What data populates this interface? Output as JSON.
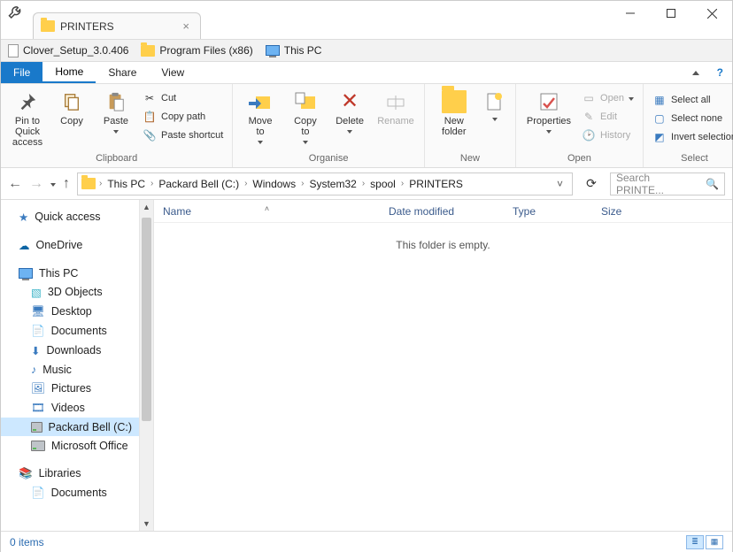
{
  "window": {
    "tab_title": "PRINTERS"
  },
  "bookmarks": [
    {
      "label": "Clover_Setup_3.0.406",
      "icon": "doc"
    },
    {
      "label": "Program Files (x86)",
      "icon": "folder"
    },
    {
      "label": "This PC",
      "icon": "pc"
    }
  ],
  "ribbon_tabs": {
    "file": "File",
    "home": "Home",
    "share": "Share",
    "view": "View"
  },
  "ribbon": {
    "clipboard": {
      "label": "Clipboard",
      "pin": "Pin to Quick access",
      "copy": "Copy",
      "paste": "Paste",
      "cut": "Cut",
      "copy_path": "Copy path",
      "paste_shortcut": "Paste shortcut"
    },
    "organise": {
      "label": "Organise",
      "move_to": "Move to",
      "copy_to": "Copy to",
      "delete": "Delete",
      "rename": "Rename"
    },
    "new": {
      "label": "New",
      "new_folder": "New folder"
    },
    "open": {
      "label": "Open",
      "properties": "Properties",
      "open": "Open",
      "edit": "Edit",
      "history": "History"
    },
    "select": {
      "label": "Select",
      "select_all": "Select all",
      "select_none": "Select none",
      "invert": "Invert selection"
    }
  },
  "breadcrumb": [
    "This PC",
    "Packard Bell (C:)",
    "Windows",
    "System32",
    "spool",
    "PRINTERS"
  ],
  "search": {
    "placeholder": "Search PRINTE..."
  },
  "columns": {
    "name": "Name",
    "date": "Date modified",
    "type": "Type",
    "size": "Size"
  },
  "content": {
    "empty_message": "This folder is empty."
  },
  "tree": {
    "quick_access": "Quick access",
    "onedrive": "OneDrive",
    "this_pc": "This PC",
    "libraries": "Libraries",
    "children": {
      "3d": "3D Objects",
      "desktop": "Desktop",
      "documents": "Documents",
      "downloads": "Downloads",
      "music": "Music",
      "pictures": "Pictures",
      "videos": "Videos",
      "drive_c": "Packard Bell (C:)",
      "ms_office": "Microsoft Office",
      "lib_documents": "Documents"
    }
  },
  "status": {
    "item_count": "0 items"
  }
}
